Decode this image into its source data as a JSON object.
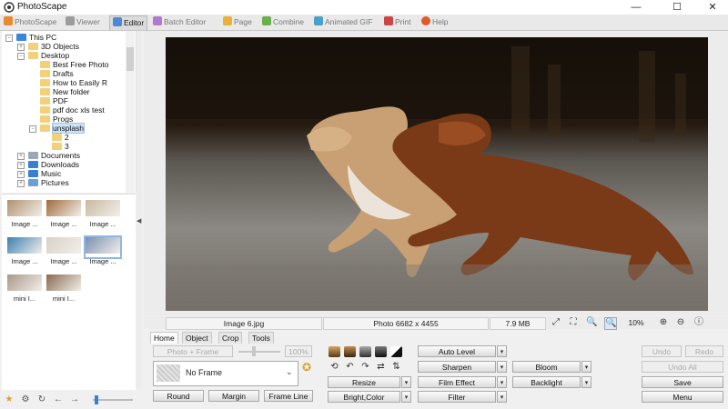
{
  "app": {
    "title": "PhotoScape"
  },
  "window": {
    "minimize": "—",
    "maximize": "☐",
    "close": "✕"
  },
  "tabs": [
    {
      "label": "PhotoScape",
      "color": "#e88b2e"
    },
    {
      "label": "Viewer",
      "color": "#9c9c9c"
    },
    {
      "label": "Editor",
      "color": "#4a8ad6"
    },
    {
      "label": "Batch Editor",
      "color": "#b07acc"
    },
    {
      "label": "Page",
      "color": "#e6b23c"
    },
    {
      "label": "Combine",
      "color": "#6ab04c"
    },
    {
      "label": "Animated GIF",
      "color": "#4aa0c8"
    },
    {
      "label": "Print",
      "color": "#cc4444"
    },
    {
      "label": "Help",
      "color": "#e05a2a"
    }
  ],
  "tree": [
    {
      "label": "This PC",
      "depth": 0,
      "icon": "pc-icon",
      "expand": "−"
    },
    {
      "label": "3D Objects",
      "depth": 1,
      "icon": "folder-icon",
      "expand": "+"
    },
    {
      "label": "Desktop",
      "depth": 1,
      "icon": "folder-icon",
      "expand": "−"
    },
    {
      "label": "Best Free Photo",
      "depth": 2,
      "icon": "folder-icon",
      "expand": ""
    },
    {
      "label": "Drafts",
      "depth": 2,
      "icon": "folder-icon",
      "expand": ""
    },
    {
      "label": "How to Easily R",
      "depth": 2,
      "icon": "folder-icon",
      "expand": ""
    },
    {
      "label": "New folder",
      "depth": 2,
      "icon": "folder-icon",
      "expand": ""
    },
    {
      "label": "PDF",
      "depth": 2,
      "icon": "folder-icon",
      "expand": ""
    },
    {
      "label": "pdf doc xls test",
      "depth": 2,
      "icon": "folder-icon",
      "expand": ""
    },
    {
      "label": "Progs",
      "depth": 2,
      "icon": "folder-icon",
      "expand": ""
    },
    {
      "label": "unsplash",
      "depth": 2,
      "icon": "folder-icon",
      "expand": "−",
      "selected": true
    },
    {
      "label": "2",
      "depth": 3,
      "icon": "folder-icon",
      "expand": ""
    },
    {
      "label": "3",
      "depth": 3,
      "icon": "folder-icon",
      "expand": ""
    },
    {
      "label": "Documents",
      "depth": 1,
      "icon": "documents-icon",
      "expand": "+"
    },
    {
      "label": "Downloads",
      "depth": 1,
      "icon": "downloads-icon",
      "expand": "+"
    },
    {
      "label": "Music",
      "depth": 1,
      "icon": "music-icon",
      "expand": "+"
    },
    {
      "label": "Pictures",
      "depth": 1,
      "icon": "pictures-icon",
      "expand": "+"
    }
  ],
  "thumbnails": [
    {
      "caption": "Image ...",
      "color": "#b09070"
    },
    {
      "caption": "Image ...",
      "color": "#a06a3a"
    },
    {
      "caption": "Image ...",
      "color": "#c8b8a0"
    },
    {
      "caption": "Image ...",
      "color": "#3c7fb0"
    },
    {
      "caption": "Image ...",
      "color": "#d8d0c8"
    },
    {
      "caption": "Image ...",
      "color": "#7a90b0",
      "selected": true
    },
    {
      "caption": "mini I...",
      "color": "#a8988a"
    },
    {
      "caption": "mini I...",
      "color": "#8a6a50"
    }
  ],
  "status": {
    "filename": "Image 6.jpg",
    "dimensions": "Photo 6682 x 4455",
    "filesize": "7.9 MB",
    "zoom": "10%"
  },
  "bottom_tabs": [
    "Home",
    "Object",
    "Crop",
    "Tools"
  ],
  "home": {
    "photo_frame_btn": "Photo + Frame",
    "opacity_value": "100%",
    "frame_value": "No Frame",
    "round_btn": "Round",
    "margin_btn": "Margin",
    "frameline_btn": "Frame Line",
    "auto_level": "Auto Level",
    "sharpen": "Sharpen",
    "bloom": "Bloom",
    "resize": "Resize",
    "film_effect": "Film Effect",
    "backlight": "Backlight",
    "bright_color": "Bright,Color",
    "filter": "Filter",
    "undo": "Undo",
    "redo": "Redo",
    "undo_all": "Undo All",
    "save": "Save",
    "menu": "Menu"
  }
}
